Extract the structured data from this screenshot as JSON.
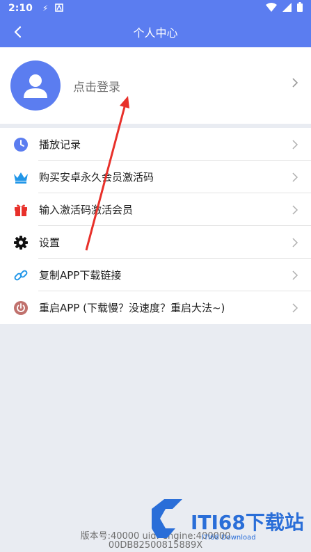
{
  "status_bar": {
    "time": "2:10"
  },
  "header": {
    "title": "个人中心"
  },
  "profile": {
    "login_text": "点击登录"
  },
  "menu": {
    "items": [
      {
        "label": "播放记录",
        "icon": "clock-icon"
      },
      {
        "label": "购买安卓永久会员激活码",
        "icon": "crown-icon"
      },
      {
        "label": "输入激活码激活会员",
        "icon": "gift-icon"
      },
      {
        "label": "设置",
        "icon": "gear-icon"
      },
      {
        "label": "复制APP下载链接",
        "icon": "link-icon"
      },
      {
        "label": "重启APP (下载慢？没速度？重启大法~)",
        "icon": "power-icon"
      }
    ]
  },
  "footer": {
    "line1": "版本号:40000 uid:    engine:400000",
    "line2": "00DB82500815889X"
  },
  "watermark": {
    "main": "ITI68下载站",
    "sub": "ITI68 Download"
  },
  "colors": {
    "primary": "#5b7df0",
    "background": "#e9ecf2",
    "annotation": "#e8302a"
  }
}
